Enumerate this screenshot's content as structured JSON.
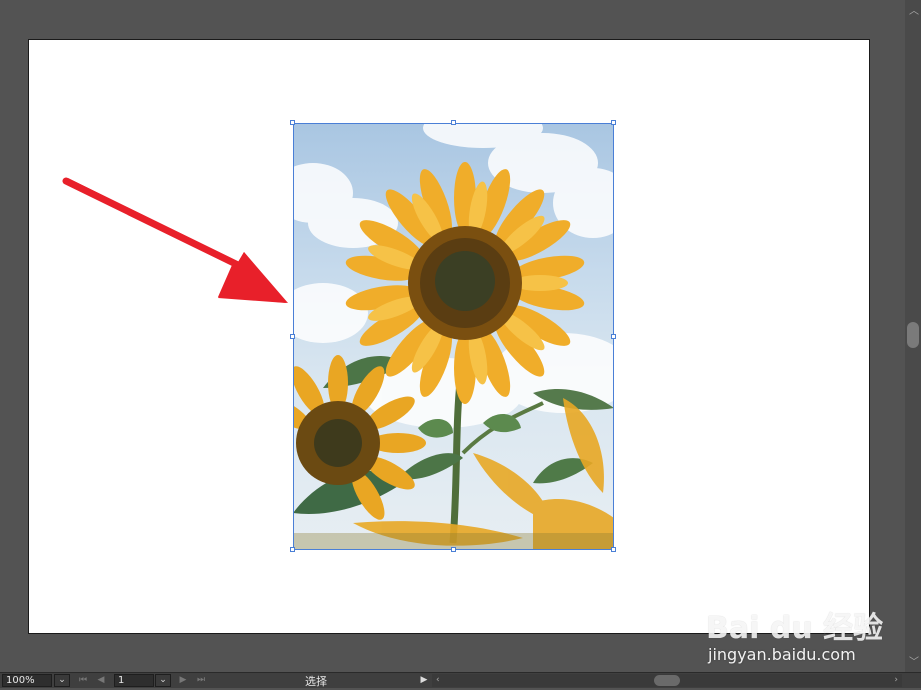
{
  "statusbar": {
    "zoom_value": "100%",
    "page_value": "1",
    "tool_status": "选择",
    "first_page_icon": "first-page-icon",
    "prev_page_icon": "prev-page-icon",
    "next_page_icon": "next-page-icon",
    "last_page_icon": "last-page-icon",
    "status_menu_icon": "triangle-right-icon"
  },
  "artboard": {
    "image_subject": "sunflower-photo",
    "selection_color": "#4a7fd6"
  },
  "annotation": {
    "arrow_color": "#e8202a"
  },
  "watermark": {
    "logo_text": "Bai du 经验",
    "url": "jingyan.baidu.com"
  }
}
